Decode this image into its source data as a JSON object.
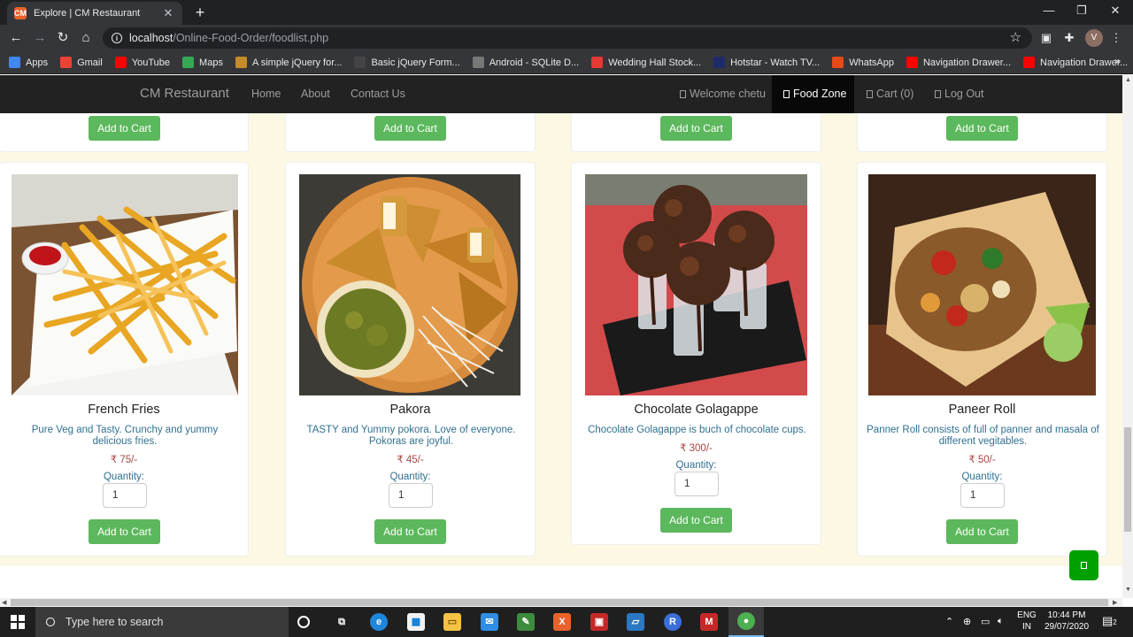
{
  "browser": {
    "tab_title": "Explore | CM Restaurant",
    "tab_favicon": "CM",
    "url_host": "localhost",
    "url_path": "/Online-Food-Order/foodlist.php",
    "profile_initial": "V",
    "bookmarks": [
      {
        "label": "Apps",
        "icon": "apps-grid-icon",
        "color": "#4285f4"
      },
      {
        "label": "Gmail",
        "icon": "gmail-icon",
        "color": "#ea4335"
      },
      {
        "label": "YouTube",
        "icon": "youtube-icon",
        "color": "#ff0000"
      },
      {
        "label": "Maps",
        "icon": "maps-pin-icon",
        "color": "#34a853"
      },
      {
        "label": "A simple jQuery for...",
        "icon": "bookmark-favicon-icon",
        "color": "#c58a2a"
      },
      {
        "label": "Basic jQuery Form...",
        "icon": "bookmark-favicon-icon",
        "color": "#444444"
      },
      {
        "label": "Android - SQLite D...",
        "icon": "bookmark-favicon-icon",
        "color": "#777777"
      },
      {
        "label": "Wedding Hall Stock...",
        "icon": "bookmark-favicon-icon",
        "color": "#e53935"
      },
      {
        "label": "Hotstar - Watch TV...",
        "icon": "hotstar-icon",
        "color": "#1f2a6b"
      },
      {
        "label": "WhatsApp",
        "icon": "whatsapp-icon",
        "color": "#e64a19"
      },
      {
        "label": "Navigation Drawer...",
        "icon": "youtube-icon",
        "color": "#ff0000"
      },
      {
        "label": "Navigation Drawer...",
        "icon": "youtube-icon",
        "color": "#ff0000"
      }
    ]
  },
  "navbar": {
    "brand": "CM Restaurant",
    "links": [
      {
        "label": "Home"
      },
      {
        "label": "About"
      },
      {
        "label": "Contact Us"
      }
    ],
    "right_links": [
      {
        "label": "Welcome chetu"
      },
      {
        "label": "Food Zone",
        "active": true
      },
      {
        "label": "Cart (0)"
      },
      {
        "label": "Log Out"
      }
    ]
  },
  "top_row": {
    "button_label": "Add to Cart"
  },
  "foods": [
    {
      "name": "French Fries",
      "desc": "Pure Veg and Tasty. Crunchy and yummy delicious fries.",
      "price": "₹ 75/-",
      "quantity_label": "Quantity:",
      "quantity": "1",
      "button_label": "Add to Cart",
      "image": "french-fries-photo"
    },
    {
      "name": "Pakora",
      "desc": "TASTY and Yummy pokora. Love of everyone. Pokoras are joyful.",
      "price": "₹ 45/-",
      "quantity_label": "Quantity:",
      "quantity": "1",
      "button_label": "Add to Cart",
      "image": "pakora-photo"
    },
    {
      "name": "Chocolate Golagappe",
      "desc": "Chocolate Golagappe is buch of chocolate cups.",
      "price": "₹ 300/-",
      "quantity_label": "Quantity:",
      "quantity": "1",
      "button_label": "Add to Cart",
      "image": "chocolate-golagappe-photo"
    },
    {
      "name": "Paneer Roll",
      "desc": "Panner Roll consists of full of panner and masala of different vegitables.",
      "price": "₹ 50/-",
      "quantity_label": "Quantity:",
      "quantity": "1",
      "button_label": "Add to Cart",
      "image": "paneer-roll-photo"
    }
  ],
  "taskbar": {
    "search_placeholder": "Type here to search",
    "lang_line1": "ENG",
    "lang_line2": "IN",
    "time": "10:44 PM",
    "date": "29/07/2020",
    "notification_count": "2"
  },
  "colors": {
    "button_green": "#5cb85c",
    "price_red": "#a94442",
    "desc_blue": "#31708f",
    "content_bg": "#fcf8e3",
    "navbar_bg": "#222222"
  }
}
